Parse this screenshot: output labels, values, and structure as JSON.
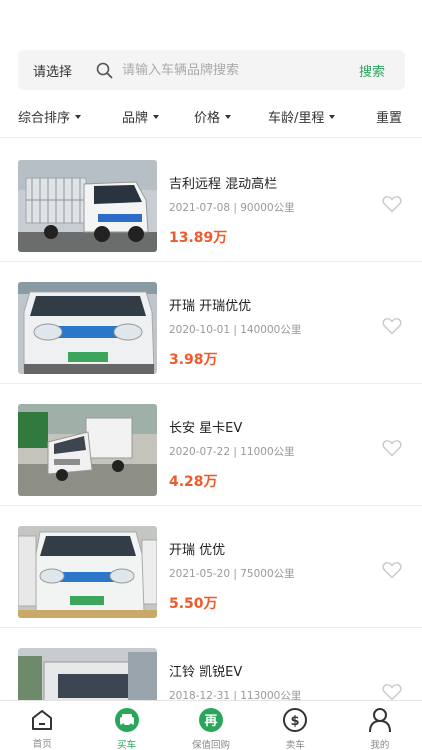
{
  "search": {
    "select_label": "请选择",
    "placeholder": "请输入车辆品牌搜索",
    "button_label": "搜索"
  },
  "filters": {
    "sort": "综合排序",
    "brand": "品牌",
    "price": "价格",
    "age": "车龄/里程",
    "reset": "重置"
  },
  "listings": [
    {
      "title": "吉利远程 混动高栏",
      "date": "2021-07-08",
      "mileage": "90000公里",
      "meta": "2021-07-08 | 90000公里",
      "price": "13.89万"
    },
    {
      "title": "开瑞 开瑞优优",
      "date": "2020-10-01",
      "mileage": "140000公里",
      "meta": "2020-10-01 | 140000公里",
      "price": "3.98万"
    },
    {
      "title": "长安 星卡EV",
      "date": "2020-07-22",
      "mileage": "11000公里",
      "meta": "2020-07-22 | 11000公里",
      "price": "4.28万"
    },
    {
      "title": "开瑞 优优",
      "date": "2021-05-20",
      "mileage": "75000公里",
      "meta": "2021-05-20 | 75000公里",
      "price": "5.50万"
    },
    {
      "title": "江铃 凯锐EV",
      "date": "2018-12-31",
      "mileage": "113000公里",
      "meta": "2018-12-31 | 113000公里",
      "price": ""
    }
  ],
  "tabs": {
    "home": "首页",
    "buy": "买车",
    "guarantee": "保值回购",
    "sell": "卖车",
    "mine": "我的",
    "guarantee_glyph": "再",
    "sell_glyph": "$"
  },
  "colors": {
    "accent": "#2aa65a",
    "price": "#f05a2a"
  }
}
